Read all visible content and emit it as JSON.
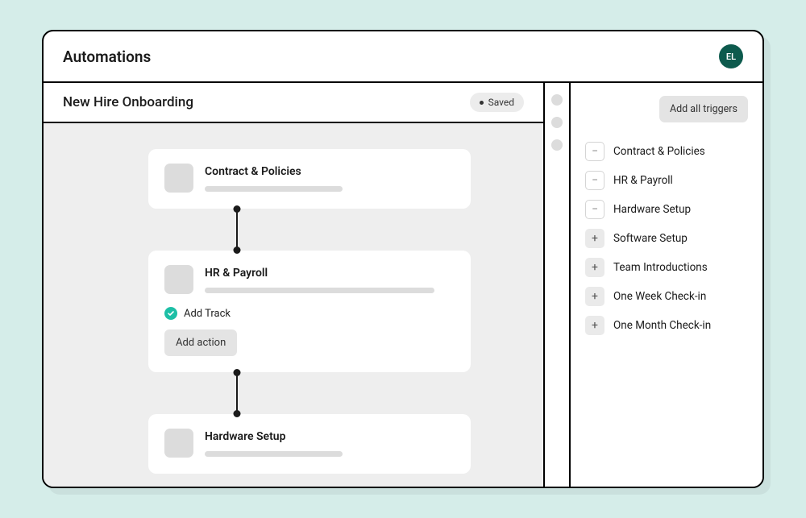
{
  "header": {
    "title": "Automations",
    "avatar_initials": "EL"
  },
  "workflow": {
    "title": "New Hire Onboarding",
    "status_label": "Saved"
  },
  "cards": [
    {
      "title": "Contract & Policies",
      "expanded": false
    },
    {
      "title": "HR & Payroll",
      "expanded": true,
      "add_track_label": "Add Track",
      "add_action_label": "Add action"
    },
    {
      "title": "Hardware Setup",
      "expanded": false
    }
  ],
  "right_panel": {
    "add_all_label": "Add all triggers",
    "triggers": [
      {
        "label": "Contract & Policies",
        "state": "minus"
      },
      {
        "label": "HR & Payroll",
        "state": "minus"
      },
      {
        "label": "Hardware Setup",
        "state": "minus"
      },
      {
        "label": "Software Setup",
        "state": "plus"
      },
      {
        "label": "Team Introductions",
        "state": "plus"
      },
      {
        "label": "One Week Check-in",
        "state": "plus"
      },
      {
        "label": "One Month Check-in",
        "state": "plus"
      }
    ]
  }
}
